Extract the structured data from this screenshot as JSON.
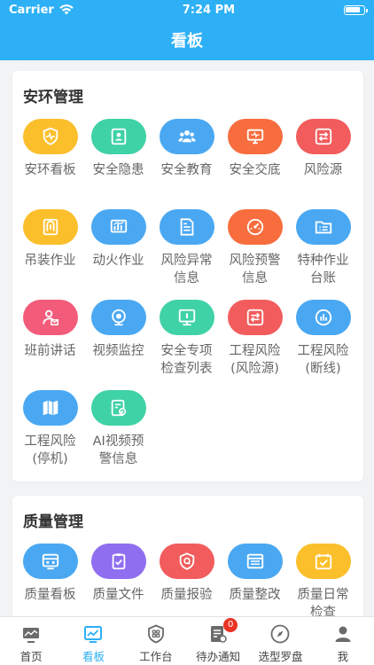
{
  "status_bar": {
    "carrier": "Carrier",
    "time": "7:24 PM"
  },
  "nav": {
    "title": "看板"
  },
  "sections": [
    {
      "title": "安环管理",
      "items": [
        {
          "label": "安环看板",
          "color": "#fbbf2c",
          "icon": "heartbeat-shield-icon"
        },
        {
          "label": "安全隐患",
          "color": "#3fd2a6",
          "icon": "id-card-icon"
        },
        {
          "label": "安全教育",
          "color": "#4aa8f2",
          "icon": "people-group-icon"
        },
        {
          "label": "安全交底",
          "color": "#f76d3e",
          "icon": "monitor-icon"
        },
        {
          "label": "风险源",
          "color": "#f25c5c",
          "icon": "exchange-arrows-icon"
        },
        {
          "label": "吊装作业",
          "color": "#fbbf2c",
          "icon": "crane-hook-icon"
        },
        {
          "label": "动火作业",
          "color": "#4aa8f2",
          "icon": "flame-board-icon"
        },
        {
          "label": "风险异常\n信息",
          "color": "#4aa8f2",
          "icon": "document-icon"
        },
        {
          "label": "风险预警\n信息",
          "color": "#f76d3e",
          "icon": "gauge-icon"
        },
        {
          "label": "特种作业\n台账",
          "color": "#4aa8f2",
          "icon": "folder-list-icon"
        },
        {
          "label": "班前讲话",
          "color": "#f25c7a",
          "icon": "user-mail-icon"
        },
        {
          "label": "视频监控",
          "color": "#4aa8f2",
          "icon": "camera-icon"
        },
        {
          "label": "安全专项\n检查列表",
          "color": "#3fd2a6",
          "icon": "info-board-icon"
        },
        {
          "label": "工程风险\n(风险源)",
          "color": "#f25c5c",
          "icon": "exchange-arrows-icon"
        },
        {
          "label": "工程风险\n(断线)",
          "color": "#4aa8f2",
          "icon": "bar-chart-icon"
        },
        {
          "label": "工程风险\n(停机)",
          "color": "#4aa8f2",
          "icon": "map-icon"
        },
        {
          "label": "AI视频预\n警信息",
          "color": "#3fd2a6",
          "icon": "clipboard-refresh-icon"
        }
      ]
    },
    {
      "title": "质量管理",
      "items": [
        {
          "label": "质量看板",
          "color": "#4aa8f2",
          "icon": "dashboard-icon"
        },
        {
          "label": "质量文件",
          "color": "#8f6ef0",
          "icon": "clipboard-check-icon"
        },
        {
          "label": "质量报验",
          "color": "#f25c5c",
          "icon": "quality-badge-icon"
        },
        {
          "label": "质量整改",
          "color": "#4aa8f2",
          "icon": "list-board-icon"
        },
        {
          "label": "质量日常\n检查",
          "color": "#fbbf2c",
          "icon": "calendar-check-icon"
        }
      ]
    }
  ],
  "tabs": [
    {
      "label": "首页",
      "icon": "home-icon",
      "active": false
    },
    {
      "label": "看板",
      "icon": "board-icon",
      "active": true
    },
    {
      "label": "工作台",
      "icon": "workbench-icon",
      "active": false
    },
    {
      "label": "待办通知",
      "icon": "todo-icon",
      "active": false,
      "badge": "0"
    },
    {
      "label": "选型罗盘",
      "icon": "compass-icon",
      "active": false
    },
    {
      "label": "我",
      "icon": "user-icon",
      "active": false
    }
  ]
}
